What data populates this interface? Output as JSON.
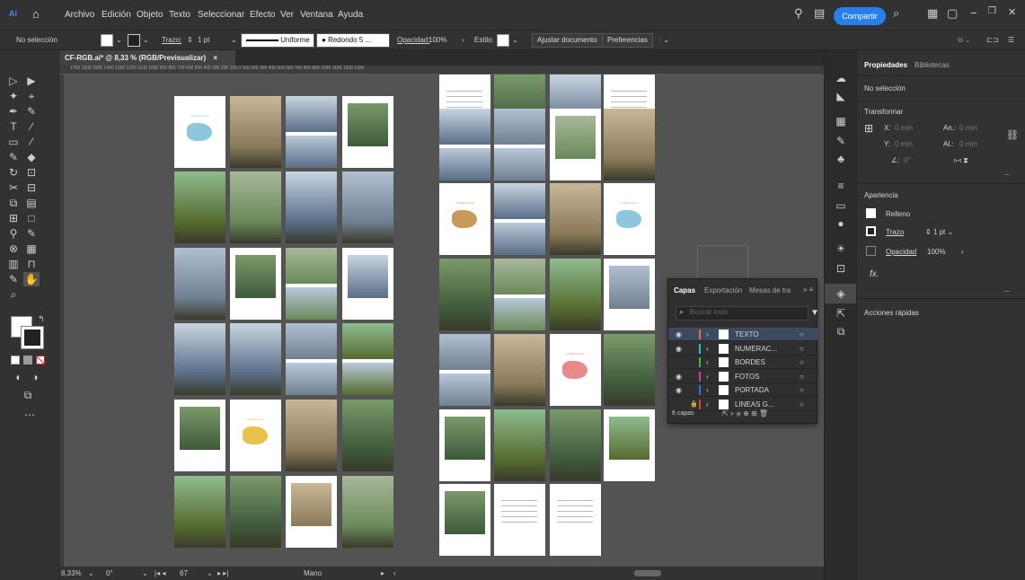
{
  "app": {
    "logo": "Ai",
    "menu": [
      "Archivo",
      "Edición",
      "Objeto",
      "Texto",
      "Seleccionar",
      "Efecto",
      "Ver",
      "Ventana",
      "Ayuda"
    ],
    "share_label": "Compartir",
    "window_controls": [
      "−",
      "❐",
      "✕"
    ]
  },
  "control_bar": {
    "selection": "No selección",
    "stroke_label": "Trazo:",
    "stroke_value": "1 pt",
    "stroke_style": "Uniforme",
    "brush": "Redondo 5 ...",
    "opacity_label": "Opacidad:",
    "opacity_value": "100%",
    "style_label": "Estilo:",
    "fit_doc": "Ajustar documento",
    "prefs": "Preferencias"
  },
  "document": {
    "tab_title": "CF-RGB.ai* @ 8,33 % (RGB/Previsualizar)",
    "tab_close": "×",
    "ruler_marks": "1700  1600  1500  1400  1300  1200  1100  1000   900   800   700   600   500   400   300   200   100     0   100   200   300   400   500   600   700   800   900  1000  1100  1200  1300"
  },
  "status": {
    "zoom": "8,33%",
    "angle": "0°",
    "artboard": "67",
    "tool": "Mano"
  },
  "properties": {
    "tabs": [
      "Propiedades",
      "Bibliotecas"
    ],
    "selection": "No selección",
    "transform": "Transformar",
    "x_label": "X:",
    "x_value": "0 mm",
    "y_label": "Y:",
    "y_value": "0 mm",
    "w_label": "An.:",
    "w_value": "0 mm",
    "h_label": "Al.:",
    "h_value": "0 mm",
    "angle_label": "∠:",
    "angle_value": "0°",
    "appearance": "Apariencia",
    "fill": "Relleno",
    "stroke": "Trazo",
    "stroke_value": "1 pt",
    "opacity": "Opacidad",
    "opacity_value": "100%",
    "fx": "fx.",
    "quick_actions": "Acciones rápidas",
    "more": "..."
  },
  "layers_panel": {
    "tabs": [
      "Capas",
      "Exportación",
      "Mesas de tra"
    ],
    "search_placeholder": "Buscar todo",
    "count": "6 capas",
    "layers": [
      {
        "name": "TEXTO",
        "color": "#e8703a",
        "visible": true,
        "selected": true
      },
      {
        "name": "NUMERAC...",
        "color": "#2bc0c8",
        "visible": true,
        "selected": false
      },
      {
        "name": "BORDES",
        "color": "#4caf50",
        "visible": false,
        "selected": false
      },
      {
        "name": "FOTOS",
        "color": "#c040c0",
        "visible": true,
        "selected": false
      },
      {
        "name": "PORTADA",
        "color": "#3a6ed8",
        "visible": true,
        "selected": false
      },
      {
        "name": "LINEAS G...",
        "color": "#d8403a",
        "visible": false,
        "locked": true,
        "selected": false
      }
    ]
  },
  "pages": {
    "map_title_1": "CUENCA ALTA",
    "map_title_2": "CUENCA ALTA",
    "map_title_3": "CUENCA ALTA",
    "map_title_4": "CUENCA ALTA",
    "map_title_5": "CUENCA ALTA"
  },
  "colors": {
    "accent": "#2680eb",
    "map_blue": "#8ec6de",
    "map_gold": "#e8c24a",
    "map_tan": "#c89a5a",
    "map_pink": "#e88a8a"
  }
}
